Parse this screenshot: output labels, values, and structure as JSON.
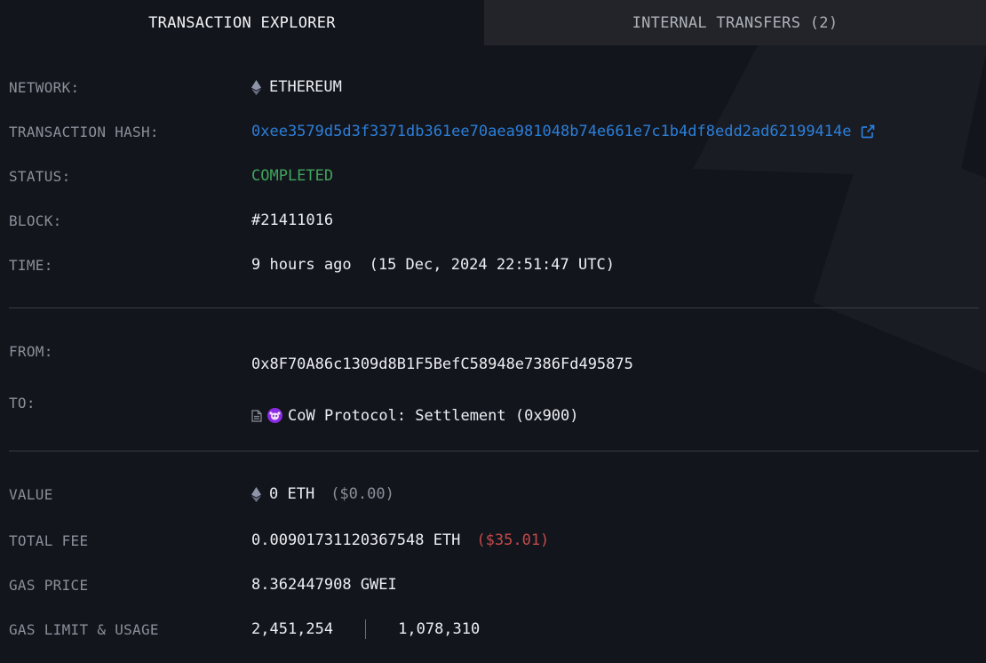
{
  "tabs": {
    "explorer": "TRANSACTION EXPLORER",
    "internal": "INTERNAL TRANSFERS (2)"
  },
  "fields": {
    "network": {
      "label": "NETWORK:",
      "value": "ETHEREUM"
    },
    "hash": {
      "label": "TRANSACTION HASH:",
      "value": "0xee3579d5d3f3371db361ee70aea981048b74e661e7c1b4df8edd2ad62199414e"
    },
    "status": {
      "label": "STATUS:",
      "value": "COMPLETED"
    },
    "block": {
      "label": "BLOCK:",
      "value": "#21411016"
    },
    "time": {
      "label": "TIME:",
      "relative": "9 hours ago",
      "absolute": "(15 Dec, 2024 22:51:47 UTC)"
    },
    "from": {
      "label": "FROM:",
      "value": "0x8F70A86c1309d8B1F5BefC58948e7386Fd495875"
    },
    "to": {
      "label": "TO:",
      "value": "CoW Protocol: Settlement (0x900)"
    },
    "value": {
      "label": "VALUE",
      "amount": "0 ETH",
      "usd": "($0.00)"
    },
    "fee": {
      "label": "TOTAL FEE",
      "amount": "0.00901731120367548 ETH",
      "usd": "($35.01)"
    },
    "gas_price": {
      "label": "GAS PRICE",
      "value": "8.362447908 GWEI"
    },
    "gas": {
      "label": "GAS LIMIT & USAGE",
      "limit": "2,451,254",
      "usage": "1,078,310"
    }
  },
  "colors": {
    "background": "#13151d",
    "link": "#2b7fd9",
    "success": "#3fa45c",
    "fee_usd": "#c34a4a",
    "label": "#8b8f99"
  },
  "icons": {
    "network": "ethereum-icon",
    "external": "external-link-icon",
    "contract": "document-icon",
    "cow": "cow-protocol-icon"
  }
}
